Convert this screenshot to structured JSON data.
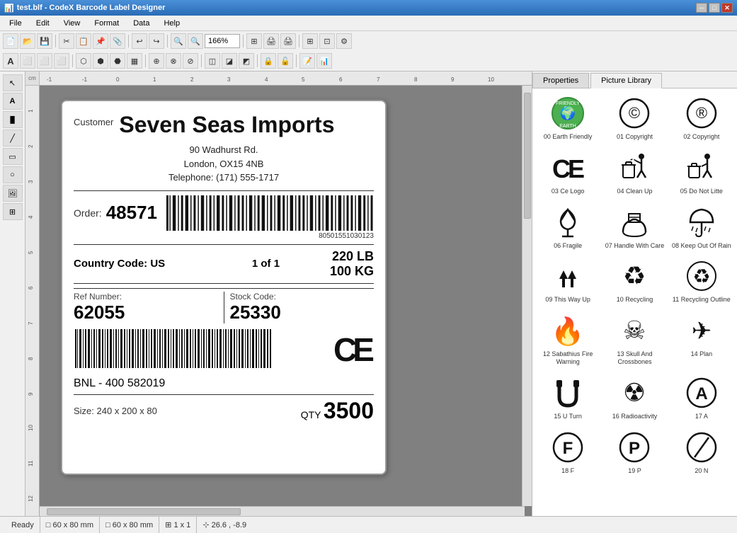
{
  "titleBar": {
    "title": "test.blf - CodeX Barcode Label Designer",
    "buttons": [
      "minimize",
      "maximize",
      "close"
    ]
  },
  "menu": {
    "items": [
      "File",
      "Edit",
      "View",
      "Format",
      "Data",
      "Help"
    ]
  },
  "toolbar": {
    "zoom": "166%"
  },
  "label": {
    "customerLabel": "Customer",
    "company": "Seven Seas Imports",
    "address1": "90 Wadhurst Rd.",
    "address2": "London, OX15 4NB",
    "telephone": "Telephone: (171) 555-1717",
    "orderLabel": "Order:",
    "orderNum": "48571",
    "barcode1": "80501551030123",
    "countryCode": "Country Code: US",
    "of": "1 of 1",
    "weight1": "220 LB",
    "weight2": "100 KG",
    "refLabel": "Ref Number:",
    "refNum": "62055",
    "stockLabel": "Stock Code:",
    "stockNum": "25330",
    "bnl": "BNL - 400 582019",
    "sizeLabel": "Size: 240 x 200 x 80",
    "qtyLabel": "QTY",
    "qtyNum": "3500"
  },
  "panels": {
    "tabs": [
      "Properties",
      "Picture Library"
    ],
    "activeTab": "Picture Library"
  },
  "pictureLibrary": {
    "items": [
      {
        "id": "00",
        "label": "00 Earth Friendly",
        "symbol": "🌍",
        "type": "earth"
      },
      {
        "id": "01",
        "label": "01 Copyright",
        "symbol": "©",
        "type": "copyright"
      },
      {
        "id": "02",
        "label": "02 Copyright",
        "symbol": "®",
        "type": "registered"
      },
      {
        "id": "03",
        "label": "03 Ce Logo",
        "symbol": "CE",
        "type": "ce"
      },
      {
        "id": "04",
        "label": "04 Clean Up",
        "symbol": "🗑",
        "type": "cleanup"
      },
      {
        "id": "05",
        "label": "05 Do Not Litte",
        "symbol": "🚯",
        "type": "nolitter"
      },
      {
        "id": "06",
        "label": "06 Fragile",
        "symbol": "🍷",
        "type": "fragile"
      },
      {
        "id": "07",
        "label": "07 Handle With Care",
        "symbol": "🤲",
        "type": "handle"
      },
      {
        "id": "08",
        "label": "08 Keep Out Of Rain",
        "symbol": "☂",
        "type": "rain"
      },
      {
        "id": "09",
        "label": "09 This Way Up",
        "symbol": "↑",
        "type": "wayup"
      },
      {
        "id": "10",
        "label": "10 Recycling",
        "symbol": "♻",
        "type": "recycling"
      },
      {
        "id": "11",
        "label": "11 Recycling Outline",
        "symbol": "♻",
        "type": "recyclingoutline"
      },
      {
        "id": "12",
        "label": "12 Sabathius Fire Warning",
        "symbol": "🔥",
        "type": "fire"
      },
      {
        "id": "13",
        "label": "13 Skull And Crossbones",
        "symbol": "☠",
        "type": "skull"
      },
      {
        "id": "14",
        "label": "14 Plan",
        "symbol": "✈",
        "type": "plan"
      },
      {
        "id": "15",
        "label": "15 U Turn",
        "symbol": "↩",
        "type": "uturn"
      },
      {
        "id": "16",
        "label": "16 Radioactivity",
        "symbol": "☢",
        "type": "radioactivity"
      },
      {
        "id": "17",
        "label": "17 A",
        "symbol": "Ⓐ",
        "type": "a"
      },
      {
        "id": "18",
        "label": "18 F",
        "symbol": "Ⓕ",
        "type": "f"
      },
      {
        "id": "19",
        "label": "19 P",
        "symbol": "Ⓟ",
        "type": "p"
      },
      {
        "id": "20",
        "label": "20 N",
        "symbol": "⌀",
        "type": "n"
      }
    ]
  },
  "statusBar": {
    "ready": "Ready",
    "size1": "60 x 80 mm",
    "size2": "60 x 80 mm",
    "pages": "1 x 1",
    "coords": "26.6 , -8.9"
  }
}
